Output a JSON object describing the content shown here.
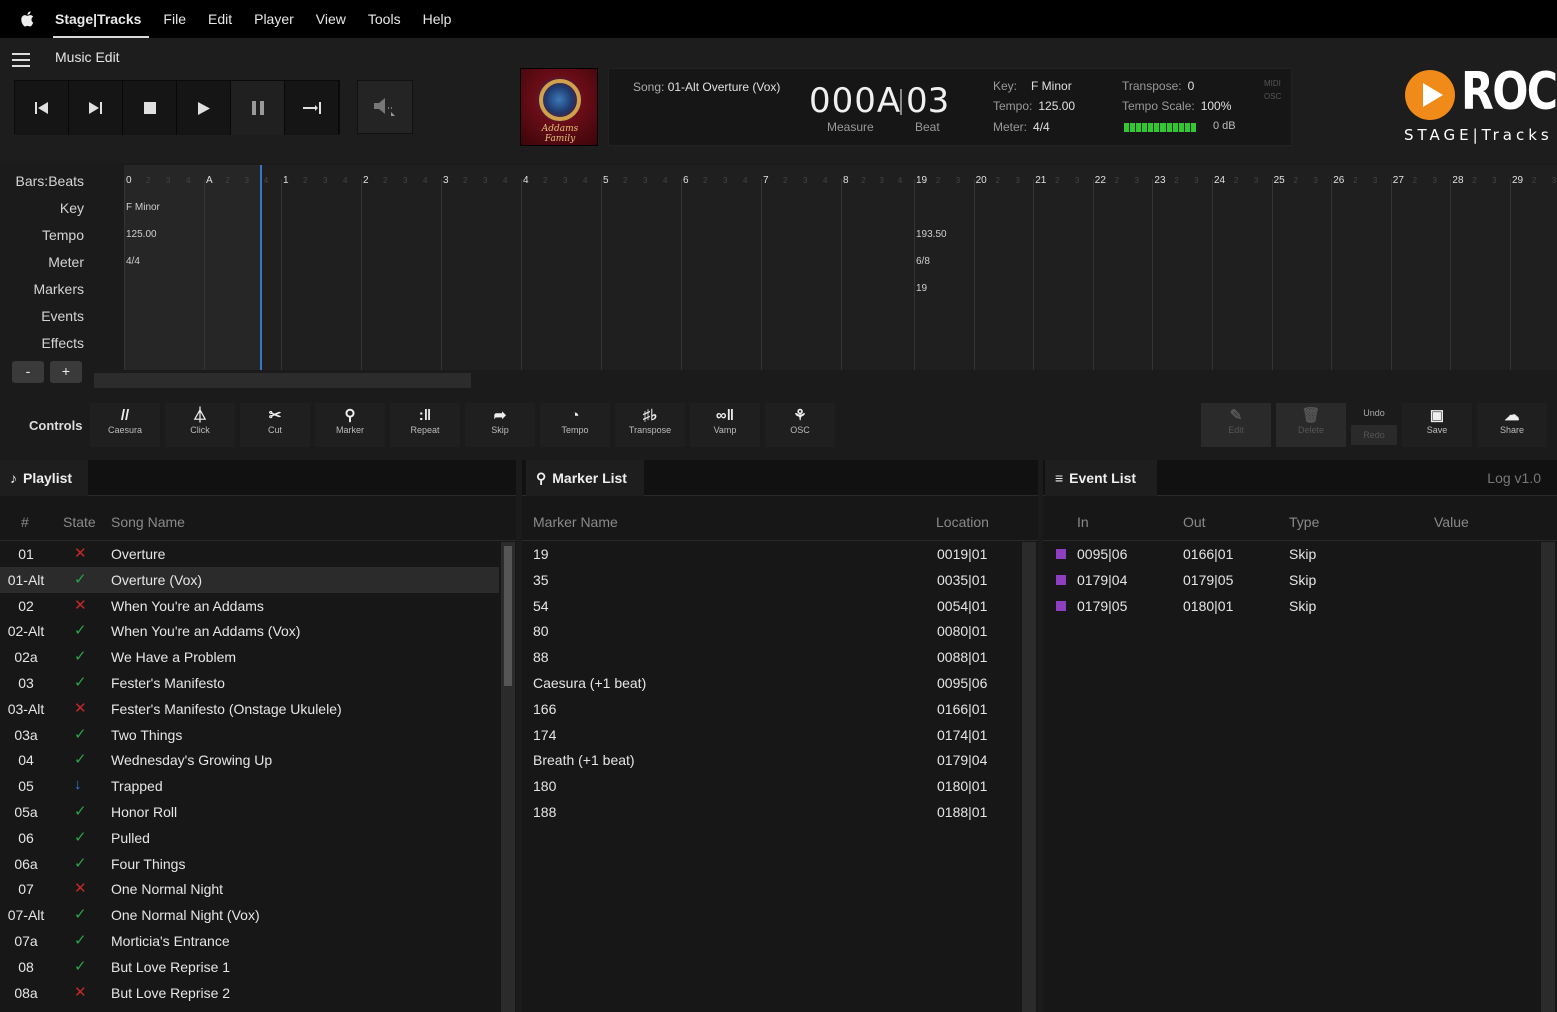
{
  "menubar": {
    "app": "Stage|Tracks",
    "items": [
      "File",
      "Edit",
      "Player",
      "View",
      "Tools",
      "Help"
    ]
  },
  "topbar": {
    "mode": "Music Edit"
  },
  "now_playing": {
    "song_label": "Song:",
    "song_name": "01-Alt Overture (Vox)",
    "measure": "000A",
    "beat": "03",
    "measure_label": "Measure",
    "beat_label": "Beat",
    "key_label": "Key:",
    "key": "F Minor",
    "tempo_label": "Tempo:",
    "tempo": "125.00",
    "meter_label": "Meter:",
    "meter": "4/4",
    "transpose_label": "Transpose:",
    "transpose": "0",
    "tempo_scale_label": "Tempo Scale:",
    "tempo_scale": "100%",
    "gain": "0 dB",
    "midi": "MIDI",
    "osc": "OSC",
    "album_text": "Addams Family"
  },
  "logo": {
    "rocs": "ROCS",
    "sub": "STAGE|Tracks",
    "accent": "#f08a18"
  },
  "timeline": {
    "row_labels": [
      "Bars:Beats",
      "Key",
      "Tempo",
      "Meter",
      "Markers",
      "Events",
      "Effects"
    ],
    "bars": [
      "0",
      "A",
      "1",
      "2",
      "3",
      "4",
      "5",
      "6",
      "7",
      "8",
      "19",
      "20",
      "21",
      "22",
      "23",
      "24",
      "25",
      "26",
      "27",
      "28",
      "29"
    ],
    "key_cells": [
      {
        "bar": "0",
        "text": "F Minor"
      }
    ],
    "tempo_cells": [
      {
        "bar": "0",
        "text": "125.00"
      },
      {
        "bar": "19",
        "text": "193.50"
      }
    ],
    "meter_cells": [
      {
        "bar": "0",
        "text": "4/4"
      },
      {
        "bar": "19",
        "text": "6/8"
      }
    ],
    "marker_cells": [
      {
        "bar": "19",
        "text": "19"
      }
    ],
    "zoom_out": "-",
    "zoom_in": "+"
  },
  "controls": {
    "title": "Controls",
    "buttons": [
      {
        "label": "Caesura",
        "icon": "//"
      },
      {
        "label": "Click",
        "icon": "⏃"
      },
      {
        "label": "Cut",
        "icon": "✂"
      },
      {
        "label": "Marker",
        "icon": "⚲"
      },
      {
        "label": "Repeat",
        "icon": ":‖"
      },
      {
        "label": "Skip",
        "icon": "➦"
      },
      {
        "label": "Tempo",
        "icon": "◔"
      },
      {
        "label": "Transpose",
        "icon": "♯♭"
      },
      {
        "label": "Vamp",
        "icon": "∞‖"
      },
      {
        "label": "OSC",
        "icon": "⚘"
      }
    ],
    "right": [
      {
        "label": "Edit",
        "icon": "✎",
        "enabled": false
      },
      {
        "label": "Delete",
        "icon": "🗑",
        "enabled": false
      },
      {
        "label": "Save",
        "icon": "▣",
        "enabled": true
      },
      {
        "label": "Share",
        "icon": "☁",
        "enabled": true
      }
    ],
    "undo": "Undo",
    "redo": "Redo"
  },
  "playlist": {
    "title": "Playlist",
    "columns": [
      "#",
      "State",
      "Song Name"
    ],
    "rows": [
      {
        "num": "01",
        "state": "x",
        "name": "Overture"
      },
      {
        "num": "01-Alt",
        "state": "ok",
        "name": "Overture (Vox)",
        "selected": true
      },
      {
        "num": "02",
        "state": "x",
        "name": "When You're an Addams"
      },
      {
        "num": "02-Alt",
        "state": "ok",
        "name": "When You're an Addams (Vox)"
      },
      {
        "num": "02a",
        "state": "ok",
        "name": "We Have a Problem"
      },
      {
        "num": "03",
        "state": "ok",
        "name": "Fester's Manifesto"
      },
      {
        "num": "03-Alt",
        "state": "x",
        "name": "Fester's Manifesto (Onstage Ukulele)"
      },
      {
        "num": "03a",
        "state": "ok",
        "name": "Two Things"
      },
      {
        "num": "04",
        "state": "ok",
        "name": "Wednesday's Growing Up"
      },
      {
        "num": "05",
        "state": "down",
        "name": "Trapped"
      },
      {
        "num": "05a",
        "state": "ok",
        "name": "Honor Roll"
      },
      {
        "num": "06",
        "state": "ok",
        "name": "Pulled"
      },
      {
        "num": "06a",
        "state": "ok",
        "name": "Four Things"
      },
      {
        "num": "07",
        "state": "x",
        "name": "One Normal Night"
      },
      {
        "num": "07-Alt",
        "state": "ok",
        "name": "One Normal Night (Vox)"
      },
      {
        "num": "07a",
        "state": "ok",
        "name": "Morticia's Entrance"
      },
      {
        "num": "08",
        "state": "ok",
        "name": "But Love Reprise 1"
      },
      {
        "num": "08a",
        "state": "x",
        "name": "But Love Reprise 2"
      }
    ]
  },
  "markers": {
    "title": "Marker List",
    "columns": [
      "Marker Name",
      "Location"
    ],
    "rows": [
      {
        "name": "19",
        "loc": "0019|01"
      },
      {
        "name": "35",
        "loc": "0035|01"
      },
      {
        "name": "54",
        "loc": "0054|01"
      },
      {
        "name": "80",
        "loc": "0080|01"
      },
      {
        "name": "88",
        "loc": "0088|01"
      },
      {
        "name": "Caesura (+1 beat)",
        "loc": "0095|06"
      },
      {
        "name": "166",
        "loc": "0166|01"
      },
      {
        "name": "174",
        "loc": "0174|01"
      },
      {
        "name": "Breath (+1 beat)",
        "loc": "0179|04"
      },
      {
        "name": "180",
        "loc": "0180|01"
      },
      {
        "name": "188",
        "loc": "0188|01"
      }
    ]
  },
  "events": {
    "title": "Event List",
    "log": "Log v1.0",
    "columns": [
      "In",
      "Out",
      "Type",
      "Value"
    ],
    "rows": [
      {
        "in": "0095|06",
        "out": "0166|01",
        "type": "Skip",
        "value": ""
      },
      {
        "in": "0179|04",
        "out": "0179|05",
        "type": "Skip",
        "value": ""
      },
      {
        "in": "0179|05",
        "out": "0180|01",
        "type": "Skip",
        "value": ""
      }
    ],
    "color": "#8d3fbf"
  }
}
